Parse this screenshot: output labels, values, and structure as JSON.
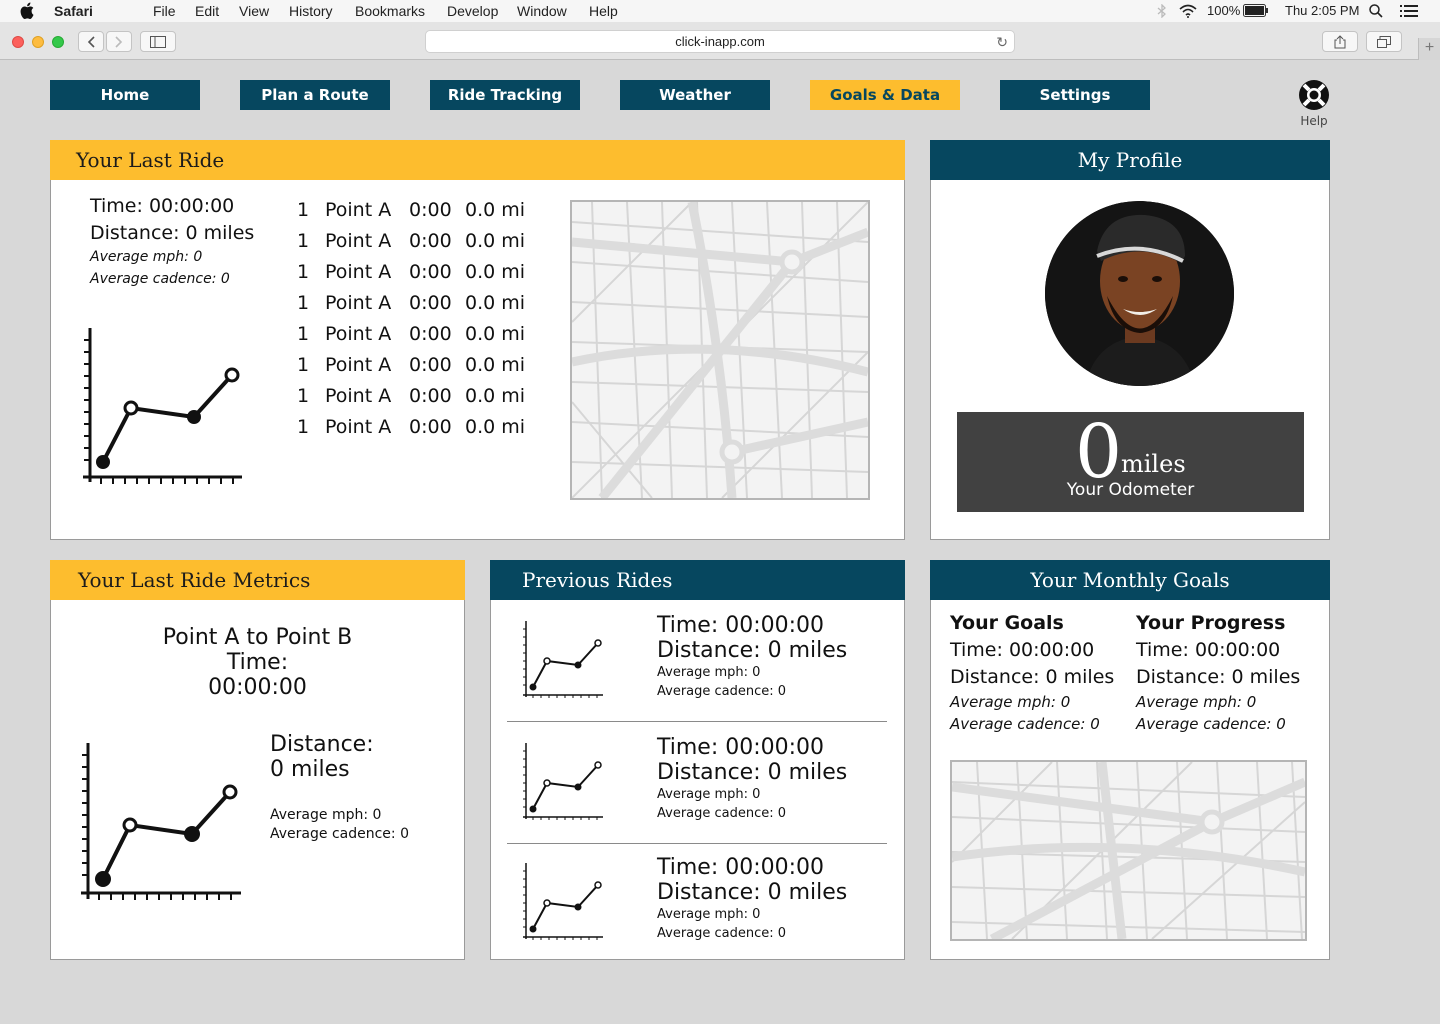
{
  "menubar": {
    "app": "Safari",
    "menus": [
      "File",
      "Edit",
      "View",
      "History",
      "Bookmarks",
      "Develop",
      "Window",
      "Help"
    ],
    "battery": "100%",
    "clock": "Thu 2:05 PM"
  },
  "browser": {
    "url": "click-inapp.com"
  },
  "nav": {
    "items": [
      "Home",
      "Plan a Route",
      "Ride Tracking",
      "Weather",
      "Goals & Data",
      "Settings"
    ],
    "active": "Goals & Data",
    "help_label": "Help"
  },
  "last_ride": {
    "title": "Your Last Ride",
    "time": "Time: 00:00:00",
    "distance": "Distance: 0 miles",
    "mph": "Average mph: 0",
    "cadence": "Average cadence: 0",
    "segments": [
      {
        "num": "1",
        "point": "Point A",
        "time": "0:00",
        "dist": "0.0 mi"
      },
      {
        "num": "1",
        "point": "Point A",
        "time": "0:00",
        "dist": "0.0 mi"
      },
      {
        "num": "1",
        "point": "Point A",
        "time": "0:00",
        "dist": "0.0 mi"
      },
      {
        "num": "1",
        "point": "Point A",
        "time": "0:00",
        "dist": "0.0 mi"
      },
      {
        "num": "1",
        "point": "Point A",
        "time": "0:00",
        "dist": "0.0 mi"
      },
      {
        "num": "1",
        "point": "Point A",
        "time": "0:00",
        "dist": "0.0 mi"
      },
      {
        "num": "1",
        "point": "Point A",
        "time": "0:00",
        "dist": "0.0 mi"
      },
      {
        "num": "1",
        "point": "Point A",
        "time": "0:00",
        "dist": "0.0 mi"
      }
    ]
  },
  "profile": {
    "title": "My Profile",
    "odometer_value": "0",
    "odometer_unit": "miles",
    "odometer_label": "Your Odometer"
  },
  "metrics": {
    "title": "Your Last Ride Metrics",
    "route": "Point A to Point B",
    "time_label": "Time:",
    "time_value": "00:00:00",
    "distance_label": "Distance:",
    "distance_value": "0 miles",
    "mph": "Average mph: 0",
    "cadence": "Average cadence: 0"
  },
  "previous_rides": {
    "title": "Previous Rides",
    "rides": [
      {
        "time": "Time: 00:00:00",
        "distance": "Distance: 0 miles",
        "mph": "Average mph: 0",
        "cadence": "Average cadence: 0"
      },
      {
        "time": "Time: 00:00:00",
        "distance": "Distance: 0 miles",
        "mph": "Average mph: 0",
        "cadence": "Average cadence: 0"
      },
      {
        "time": "Time: 00:00:00",
        "distance": "Distance: 0 miles",
        "mph": "Average mph: 0",
        "cadence": "Average cadence: 0"
      }
    ]
  },
  "goals": {
    "title": "Your Monthly Goals",
    "goals_heading": "Your Goals",
    "progress_heading": "Your Progress",
    "goal_time": "Time: 00:00:00",
    "goal_distance": "Distance: 0 miles",
    "goal_mph": "Average mph: 0",
    "goal_cadence": "Average cadence: 0",
    "progress_time": "Time: 00:00:00",
    "progress_distance": "Distance: 0 miles",
    "progress_mph": "Average mph: 0",
    "progress_cadence": "Average cadence: 0"
  },
  "colors": {
    "accent_blue": "#06475f",
    "accent_yellow": "#fdbd2e",
    "odometer_bg": "#414141"
  }
}
